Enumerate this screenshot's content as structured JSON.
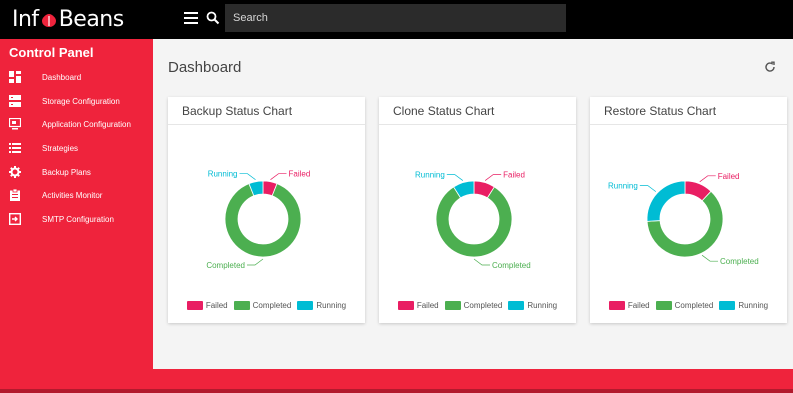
{
  "brand": {
    "logo_left": "Inf",
    "logo_right": "Beans"
  },
  "search": {
    "placeholder": "Search"
  },
  "sidebar": {
    "title": "Control Panel",
    "items": [
      {
        "label": "Dashboard",
        "icon": "dashboard-icon"
      },
      {
        "label": "Storage Configuration",
        "icon": "storage-icon"
      },
      {
        "label": "Application Configuration",
        "icon": "application-icon"
      },
      {
        "label": "Strategies",
        "icon": "list-icon"
      },
      {
        "label": "Backup Plans",
        "icon": "gear-icon"
      },
      {
        "label": "Activities Monitor",
        "icon": "clipboard-icon"
      },
      {
        "label": "SMTP Configuration",
        "icon": "login-icon"
      }
    ]
  },
  "main": {
    "title": "Dashboard"
  },
  "colors": {
    "failed": "#e91e63",
    "completed": "#4caf50",
    "running": "#00bcd4",
    "accent": "#ef233c"
  },
  "legend": {
    "failed": "Failed",
    "completed": "Completed",
    "running": "Running"
  },
  "cards": [
    {
      "title": "Backup Status Chart"
    },
    {
      "title": "Clone Status Chart"
    },
    {
      "title": "Restore Status Chart"
    }
  ],
  "chart_data": [
    {
      "type": "pie",
      "title": "Backup Status Chart",
      "categories": [
        "Failed",
        "Completed",
        "Running"
      ],
      "values": [
        6,
        88,
        6
      ]
    },
    {
      "type": "pie",
      "title": "Clone Status Chart",
      "categories": [
        "Failed",
        "Completed",
        "Running"
      ],
      "values": [
        9,
        82,
        9
      ]
    },
    {
      "type": "pie",
      "title": "Restore Status Chart",
      "categories": [
        "Failed",
        "Completed",
        "Running"
      ],
      "values": [
        12,
        62,
        26
      ]
    }
  ]
}
